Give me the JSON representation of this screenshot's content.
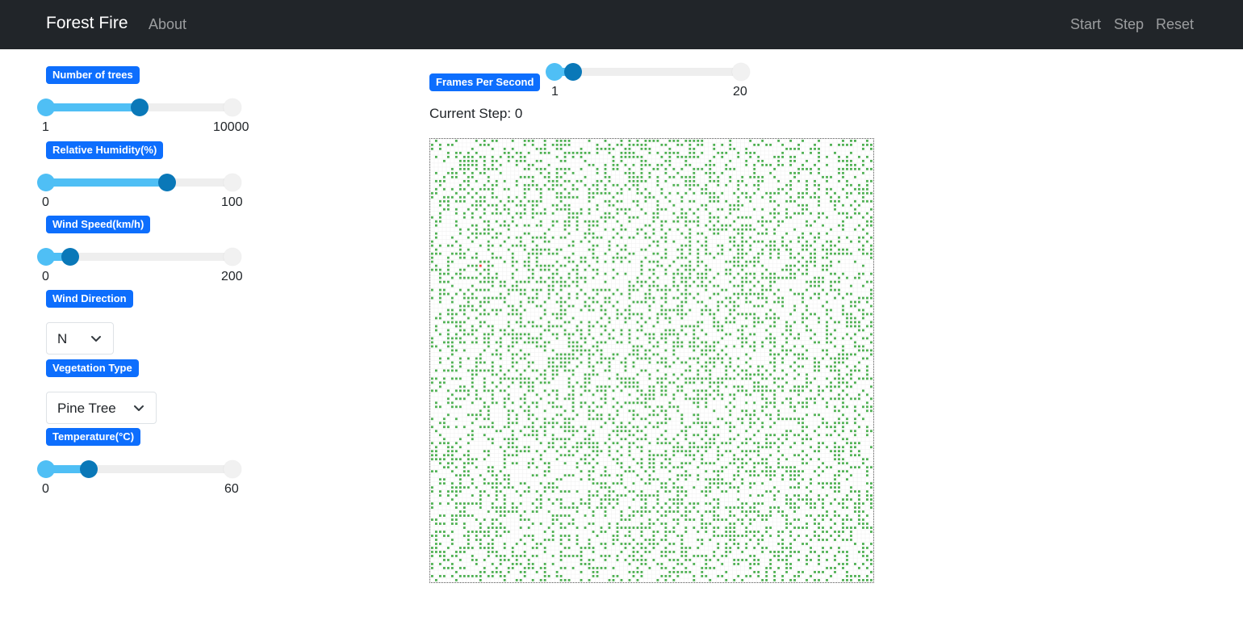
{
  "navbar": {
    "brand": "Forest Fire",
    "links": {
      "about": "About",
      "start": "Start",
      "step": "Step",
      "reset": "Reset"
    }
  },
  "controls": {
    "trees": {
      "label": "Number of trees",
      "min": "1",
      "max": "10000",
      "fraction": 0.5
    },
    "humidity": {
      "label": "Relative Humidity(%)",
      "min": "0",
      "max": "100",
      "fraction": 0.65
    },
    "wind_speed": {
      "label": "Wind Speed(km/h)",
      "min": "0",
      "max": "200",
      "fraction": 0.13
    },
    "wind_direction": {
      "label": "Wind Direction",
      "value": "N"
    },
    "vegetation": {
      "label": "Vegetation Type",
      "value": "Pine Tree"
    },
    "temperature": {
      "label": "Temperature(°C)",
      "min": "0",
      "max": "60",
      "fraction": 0.23
    }
  },
  "simulation": {
    "fps": {
      "label": "Frames Per Second",
      "min": "1",
      "max": "20",
      "fraction": 0.1
    },
    "current_step": "Current Step: 0"
  },
  "colors": {
    "navbar": "#212529",
    "badge": "#0d6efd",
    "slider_fill": "#4fbff5",
    "slider_knob": "#0a78b8",
    "tree": "#4caf50",
    "fire": "#f44336"
  }
}
